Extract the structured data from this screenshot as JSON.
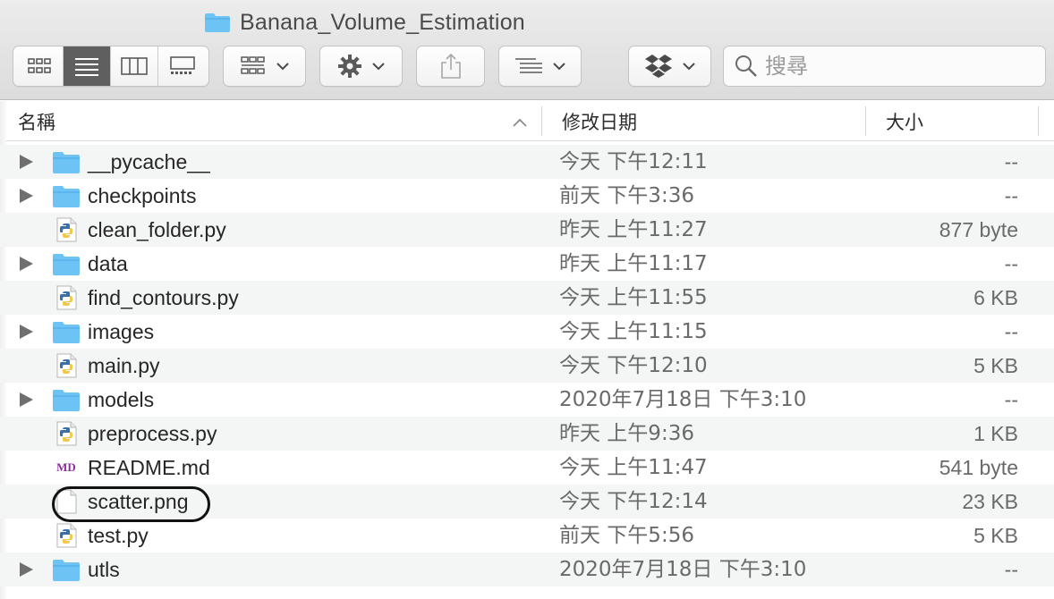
{
  "window": {
    "title": "Banana_Volume_Estimation"
  },
  "toolbar": {
    "view_modes": [
      {
        "name": "icon-view",
        "active": false
      },
      {
        "name": "list-view",
        "active": true
      },
      {
        "name": "column-view",
        "active": false
      },
      {
        "name": "gallery-view",
        "active": false
      }
    ]
  },
  "search": {
    "placeholder": "搜尋"
  },
  "columns": {
    "name": "名稱",
    "date": "修改日期",
    "size": "大小"
  },
  "files": [
    {
      "name": "__pycache__",
      "type": "folder",
      "date": "今天 下午12:11",
      "size": "--"
    },
    {
      "name": "checkpoints",
      "type": "folder",
      "date": "前天 下午3:36",
      "size": "--"
    },
    {
      "name": "clean_folder.py",
      "type": "python",
      "date": "昨天 上午11:27",
      "size": "877 byte"
    },
    {
      "name": "data",
      "type": "folder",
      "date": "昨天 上午11:17",
      "size": "--"
    },
    {
      "name": "find_contours.py",
      "type": "python",
      "date": "今天 上午11:55",
      "size": "6 KB"
    },
    {
      "name": "images",
      "type": "folder",
      "date": "今天 上午11:15",
      "size": "--"
    },
    {
      "name": "main.py",
      "type": "python",
      "date": "今天 下午12:10",
      "size": "5 KB"
    },
    {
      "name": "models",
      "type": "folder",
      "date": "2020年7月18日 下午3:10",
      "size": "--"
    },
    {
      "name": "preprocess.py",
      "type": "python",
      "date": "昨天 上午9:36",
      "size": "1 KB"
    },
    {
      "name": "README.md",
      "type": "markdown",
      "icon_text": "MD",
      "date": "今天 上午11:47",
      "size": "541 byte"
    },
    {
      "name": "scatter.png",
      "type": "image",
      "date": "今天 下午12:14",
      "size": "23 KB",
      "circled": true
    },
    {
      "name": "test.py",
      "type": "python",
      "date": "前天 下午5:56",
      "size": "5 KB"
    },
    {
      "name": "utls",
      "type": "folder",
      "date": "2020年7月18日 下午3:10",
      "size": "--"
    }
  ],
  "colors": {
    "folder": "#6ec3f5",
    "folder_dark": "#4aa8e6",
    "selected_view": "#5f5f5f",
    "md_purple": "#8a2f9a",
    "python_blue": "#3a6fa8",
    "python_yellow": "#f2c94c"
  }
}
